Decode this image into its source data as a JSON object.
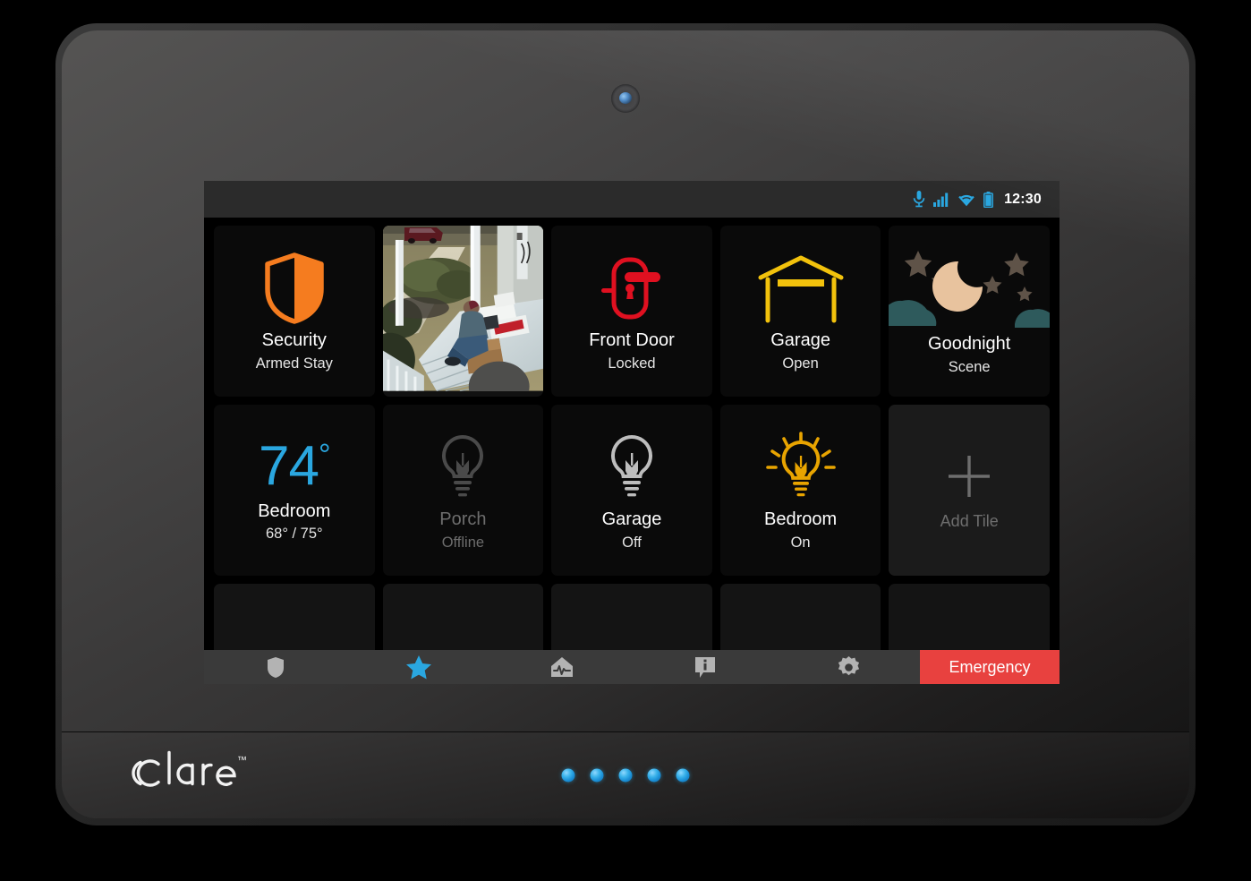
{
  "device": {
    "brand": "clare",
    "brand_tm": "™",
    "led_count": 5,
    "camera_icon": "front-camera"
  },
  "statusbar": {
    "time": "12:30",
    "icons": [
      "microphone-icon",
      "signal-bars-icon",
      "wifi-icon",
      "battery-icon"
    ],
    "accent": "#2aa7e0"
  },
  "tiles": [
    {
      "id": "security",
      "name": "Security",
      "state": "Armed Stay",
      "icon": "shield-icon",
      "color": "#f57c1f",
      "dim": false
    },
    {
      "id": "camera",
      "name": "",
      "state": "",
      "icon": "camera-feed",
      "color": "",
      "dim": false
    },
    {
      "id": "front-door",
      "name": "Front Door",
      "state": "Locked",
      "icon": "door-lock-icon",
      "color": "#e01020",
      "dim": false
    },
    {
      "id": "garage-door",
      "name": "Garage",
      "state": "Open",
      "icon": "garage-door-icon",
      "color": "#f2c20c",
      "dim": false
    },
    {
      "id": "goodnight",
      "name": "Goodnight",
      "state": "Scene",
      "icon": "moon-stars-icon",
      "color": "#e8c39e",
      "dim": false
    },
    {
      "id": "thermostat",
      "name": "Bedroom",
      "state": "68° / 75°",
      "icon": "temperature-value",
      "color": "#2aa7e0",
      "dim": false,
      "temperature": "74",
      "degree": "°"
    },
    {
      "id": "porch-light",
      "name": "Porch",
      "state": "Offline",
      "icon": "lightbulb-icon",
      "color": "#4a4a4a",
      "dim": true
    },
    {
      "id": "garage-light",
      "name": "Garage",
      "state": "Off",
      "icon": "lightbulb-icon",
      "color": "#bdbdbd",
      "dim": false
    },
    {
      "id": "bedroom-light",
      "name": "Bedroom",
      "state": "On",
      "icon": "lightbulb-on-icon",
      "color": "#e8a400",
      "dim": false
    },
    {
      "id": "add-tile",
      "name": "Add Tile",
      "state": "",
      "icon": "plus-icon",
      "color": "#6e6e6e",
      "dim": true
    }
  ],
  "empty_tiles": 5,
  "navbar": {
    "items": [
      {
        "id": "security",
        "icon": "shield-icon",
        "active": false
      },
      {
        "id": "favorites",
        "icon": "star-icon",
        "active": true
      },
      {
        "id": "home-health",
        "icon": "home-pulse-icon",
        "active": false
      },
      {
        "id": "info",
        "icon": "info-bubble-icon",
        "active": false
      },
      {
        "id": "settings",
        "icon": "gear-icon",
        "active": false
      }
    ],
    "emergency_label": "Emergency",
    "emergency_color": "#e8413f",
    "active_color": "#2aa7e0",
    "inactive_color": "#b3b3b3"
  }
}
